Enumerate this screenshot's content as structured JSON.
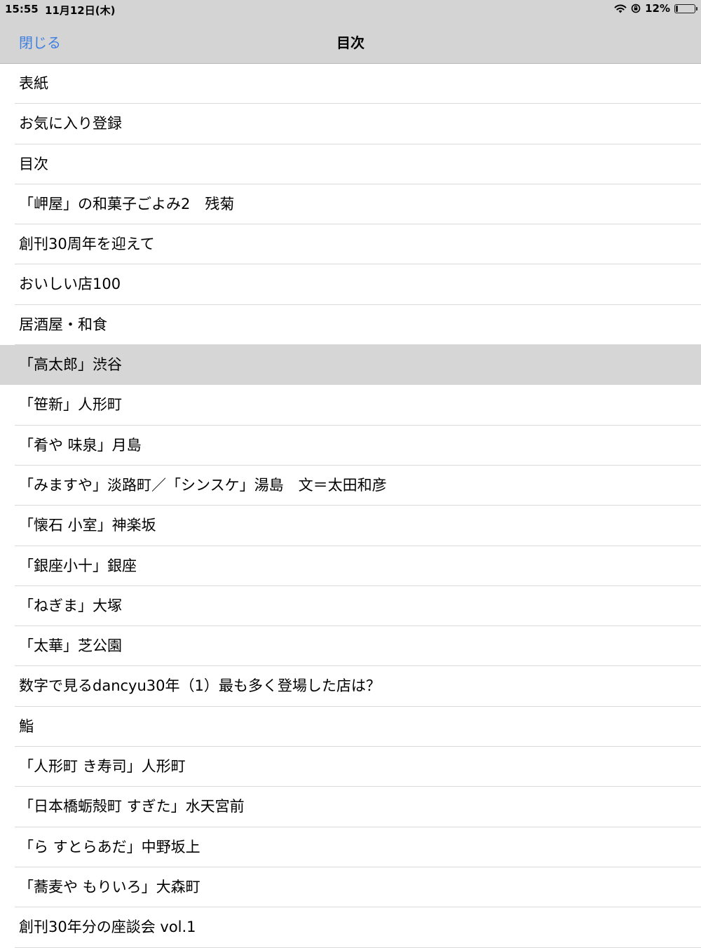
{
  "status": {
    "time": "15:55",
    "date": "11月12日(木)",
    "battery_text": "12%",
    "battery_level": 0.12
  },
  "nav": {
    "close_label": "閉じる",
    "title": "目次"
  },
  "toc": {
    "items": [
      {
        "label": "表紙"
      },
      {
        "label": "お気に入り登録"
      },
      {
        "label": "目次"
      },
      {
        "label": "「岬屋」の和菓子ごよみ2　残菊"
      },
      {
        "label": "創刊30周年を迎えて"
      },
      {
        "label": "おいしい店100"
      },
      {
        "label": "居酒屋・和食"
      },
      {
        "label": "「高太郎」渋谷",
        "selected": true
      },
      {
        "label": "「笹新」人形町"
      },
      {
        "label": "「肴や 味泉」月島"
      },
      {
        "label": "「みますや」淡路町／「シンスケ」湯島　文＝太田和彦"
      },
      {
        "label": "「懐石 小室」神楽坂"
      },
      {
        "label": "「銀座小十」銀座"
      },
      {
        "label": "「ねぎま」大塚"
      },
      {
        "label": "「太華」芝公園"
      },
      {
        "label": "数字で見るdancyu30年（1）最も多く登場した店は？"
      },
      {
        "label": "鮨"
      },
      {
        "label": "「人形町 き寿司」人形町"
      },
      {
        "label": "「日本橋蛎殻町 すぎた」水天宮前"
      },
      {
        "label": "「ら すとらあだ」中野坂上"
      },
      {
        "label": "「蕎麦や もりいろ」大森町"
      },
      {
        "label": "創刊30年分の座談会 vol.1"
      }
    ]
  }
}
